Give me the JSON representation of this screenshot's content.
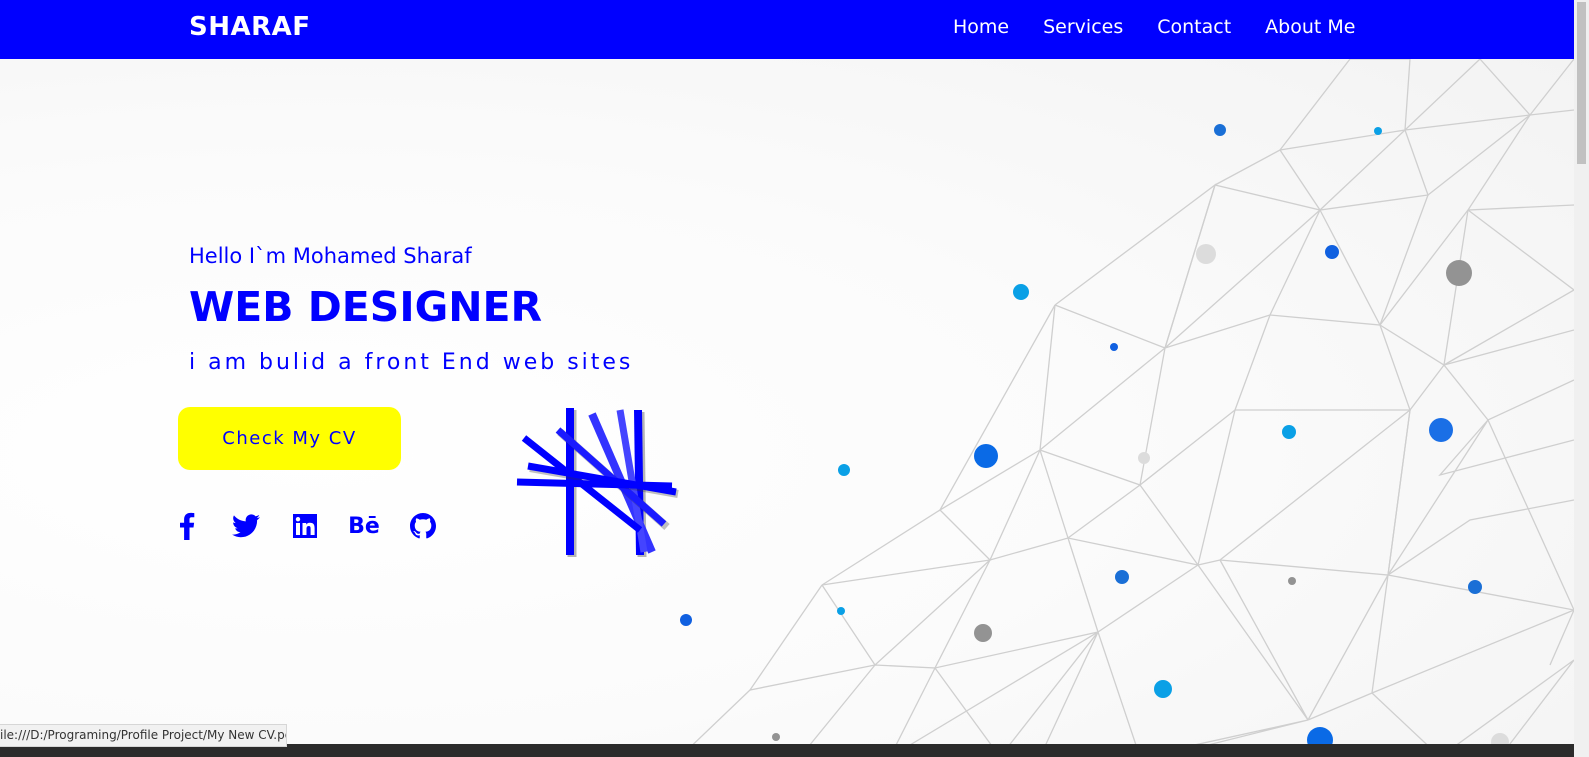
{
  "brand": "SHARAF",
  "nav": {
    "links": [
      "Home",
      "Services",
      "Contact",
      "About Me"
    ]
  },
  "hero": {
    "greeting": "Hello I`m Mohamed Sharaf",
    "role": "WEB DESIGNER",
    "tagline": "i am bulid a front End web sites",
    "cv_button": "Check My CV"
  },
  "socials": {
    "behance_text": "Bē",
    "icons": [
      "facebook-icon",
      "twitter-icon",
      "linkedin-icon",
      "behance-icon",
      "github-icon"
    ]
  },
  "status_bar": {
    "url": "ile:///D:/Programing/Profile Project/My New CV.pdf"
  },
  "colors": {
    "primary": "#0000ff",
    "button": "#ffff00",
    "white": "#ffffff"
  }
}
